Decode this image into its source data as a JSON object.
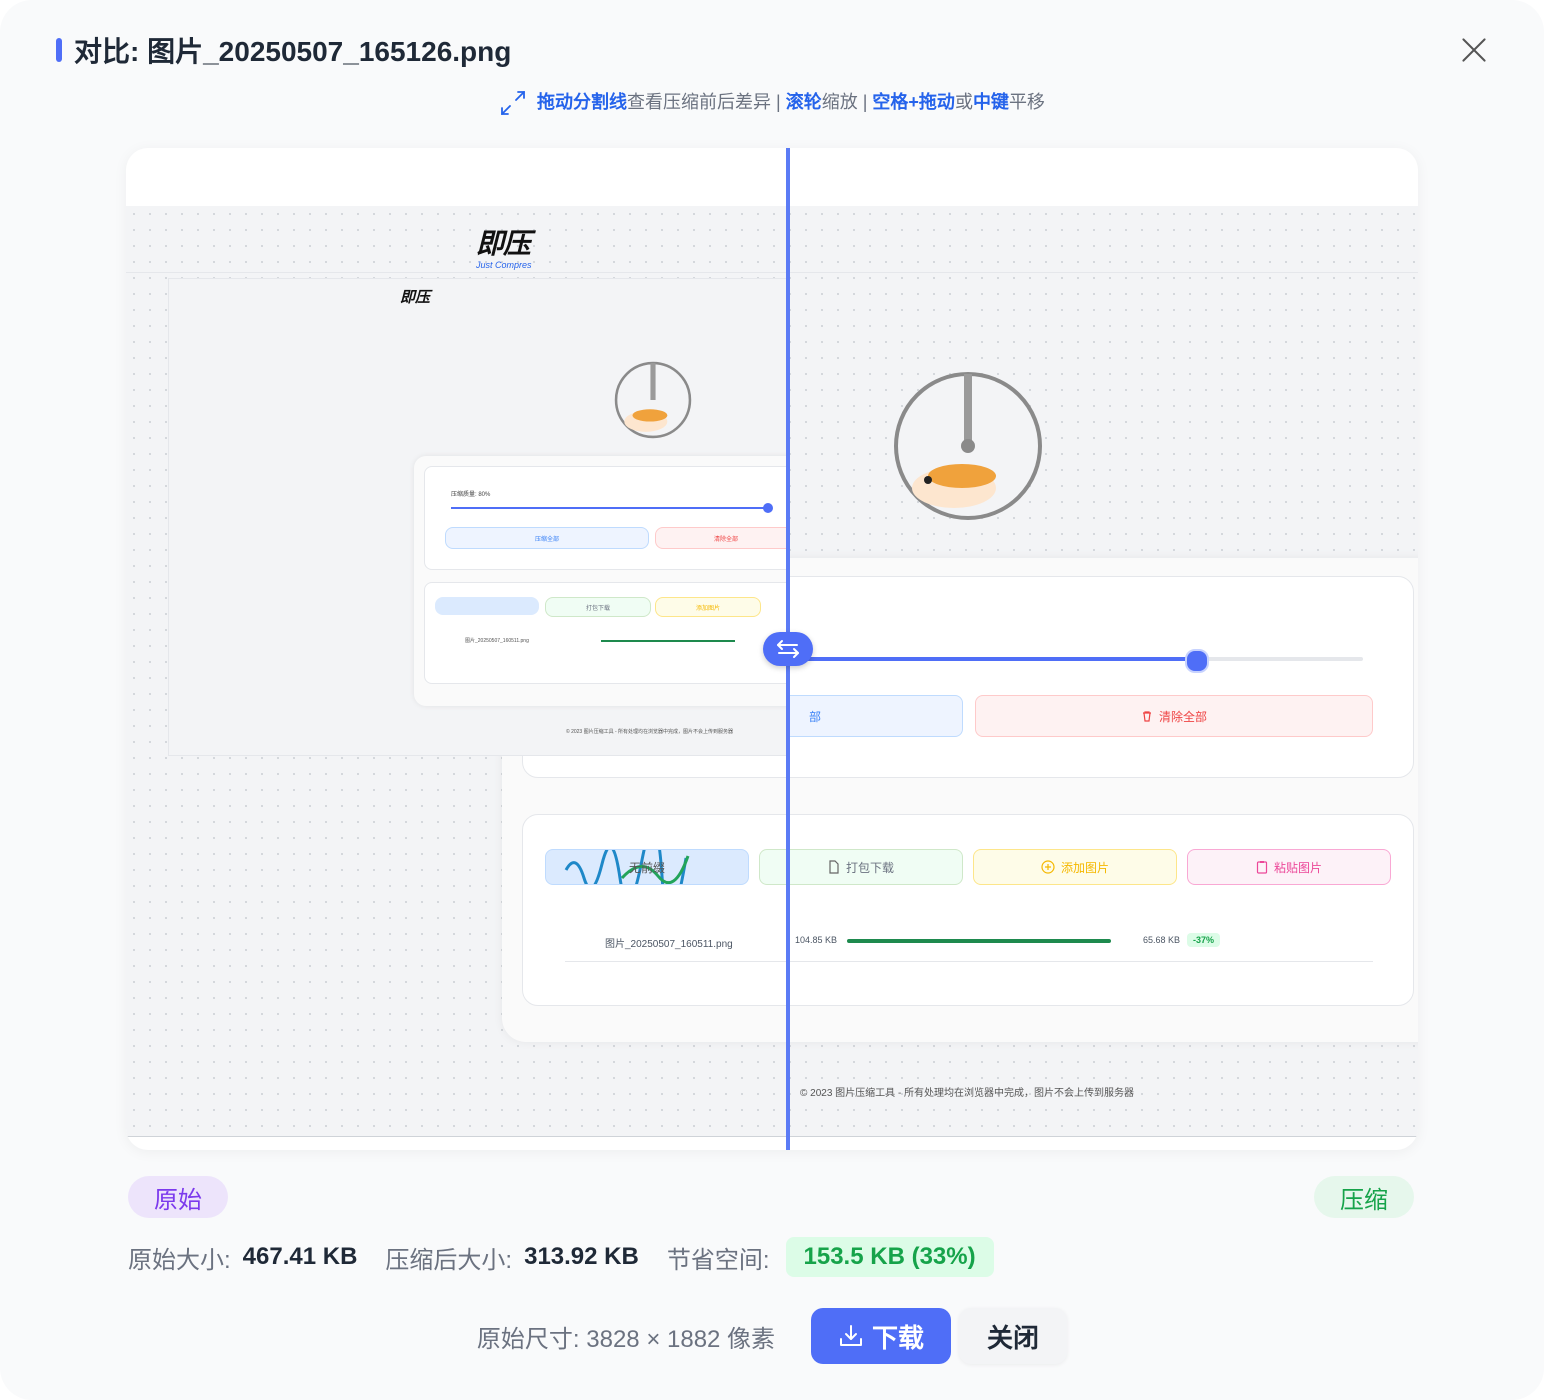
{
  "modal": {
    "title": "对比: 图片_20250507_165126.png"
  },
  "hint": {
    "drag_divider": "拖动分割线",
    "drag_divider_desc": "查看压缩前后差异 | ",
    "wheel": "滚轮",
    "wheel_desc": "缩放 | ",
    "space_drag": "空格+拖动",
    "or": "或",
    "middle_key": "中键",
    "pan": "平移"
  },
  "preview": {
    "logo_text": "即压",
    "logo_sub": "Just Compres",
    "slider_label": "压缩质量: 80%",
    "compress_all": "压缩全部",
    "compress_all_fragment": "部",
    "clear_all": "清除全部",
    "no_preview": "无前缀",
    "pack_download": "打包下载",
    "add_image": "添加图片",
    "paste_image": "粘贴图片",
    "file_name": "图片_20250507_160511.png",
    "file_orig_size": "104.85 KB",
    "file_new_size": "65.68 KB",
    "file_saving": "-37%",
    "footer_note": "© 2023 图片压缩工具 - 所有处理均在浏览器中完成，图片不会上传到服务器"
  },
  "labels": {
    "original": "原始",
    "compressed": "压缩"
  },
  "stats": {
    "original_size_label": "原始大小:",
    "original_size": "467.41 KB",
    "compressed_size_label": "压缩后大小:",
    "compressed_size": "313.92 KB",
    "saved_label": "节省空间:",
    "saved_value": "153.5 KB (33%)"
  },
  "footer": {
    "dimensions": "原始尺寸: 3828 × 1882 像素",
    "download": "下载",
    "close": "关闭"
  },
  "colors": {
    "accent": "#4f6ef7",
    "saved_bg": "#dcfce7",
    "saved_text": "#16a34a",
    "original_pill": "#7c3aed"
  },
  "icons": [
    "expand-icon",
    "close-icon",
    "swap-arrows-icon",
    "download-icon",
    "trash-icon",
    "file-icon",
    "plus-circle-icon",
    "clipboard-icon"
  ]
}
